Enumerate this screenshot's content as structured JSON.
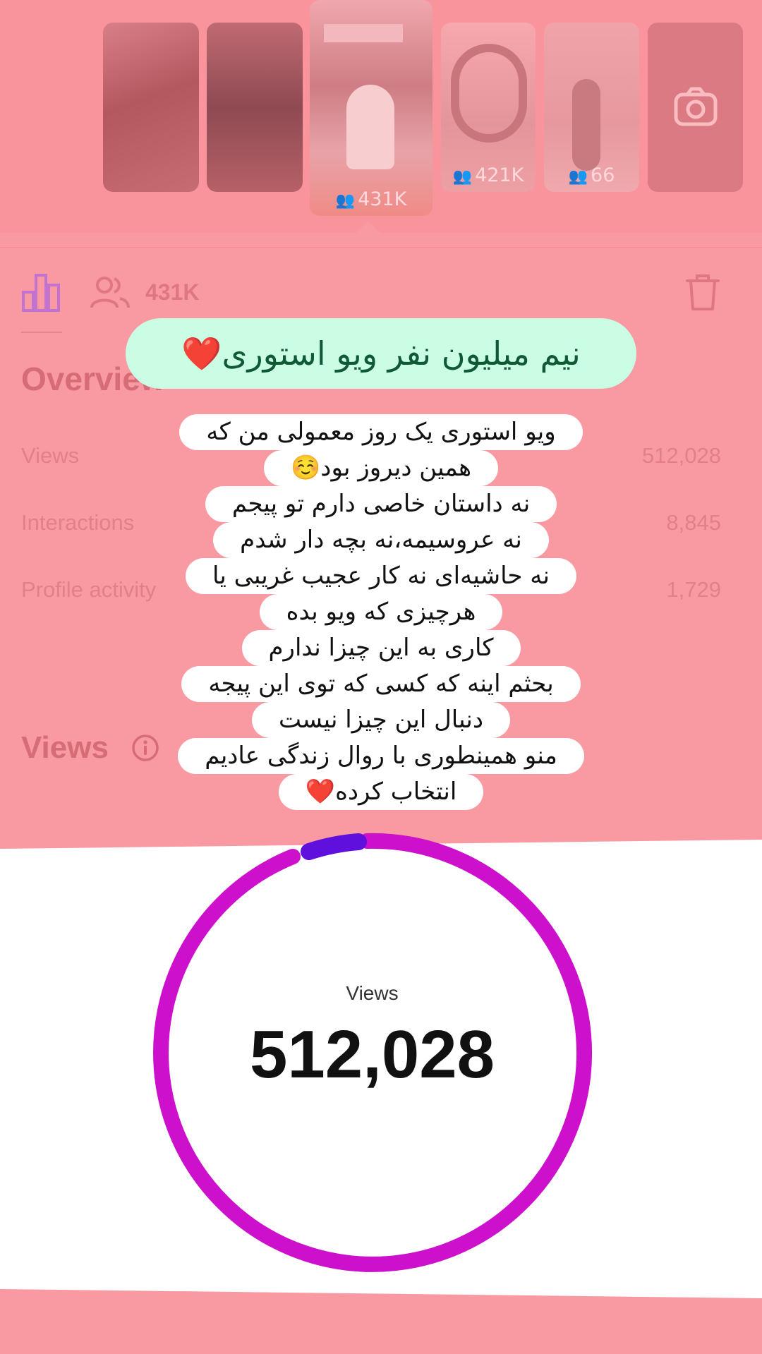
{
  "stories": [
    {
      "label": ""
    },
    {
      "label": ""
    },
    {
      "label": "431K",
      "selected": true
    },
    {
      "label": "421K"
    },
    {
      "label": "66"
    },
    {
      "label": ""
    }
  ],
  "toolbar": {
    "audience_count": "431K",
    "icons": [
      "bar-chart-icon",
      "people-icon",
      "trash-icon",
      "camera-icon"
    ]
  },
  "overview": {
    "title": "Overview",
    "rows": [
      {
        "label": "Views",
        "value": "512,028"
      },
      {
        "label": "Interactions",
        "value": "8,845"
      },
      {
        "label": "Profile activity",
        "value": "1,729"
      }
    ]
  },
  "views_section": {
    "title": "Views",
    "caption": "Views",
    "total": "512,028"
  },
  "caption_overlay": {
    "title": "نیم میلیون نفر ویو استوری❤️",
    "lines": [
      "ویو استوری یک روز معمولی من که",
      "همین دیروز بود☺️",
      "نه داستان خاصی دارم تو پیجم",
      "نه عروسیمه،نه بچه دار شدم",
      "نه حاشیه‌ای نه کار عجیب غریبی یا",
      "هرچیزی که ویو بده",
      "کاری به این چیزا ندارم",
      "بحثم اینه که کسی که توی این پیجه",
      "دنبال این چیزا نیست",
      "منو همینطوری با روال زندگی عادیم",
      "انتخاب کرده❤️"
    ]
  },
  "colors": {
    "background": "#f99aa2",
    "donut_main": "#cc10cc",
    "donut_minor": "#5f10dd",
    "title_pill": "#cbfde5"
  }
}
